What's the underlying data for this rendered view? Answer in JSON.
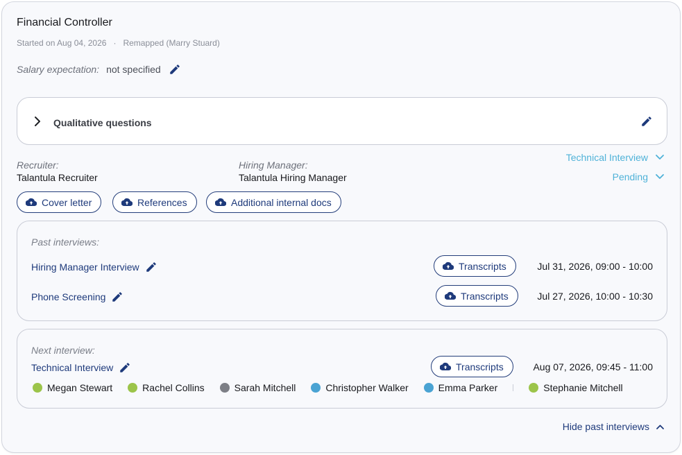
{
  "job": {
    "title": "Financial Controller",
    "started": "Started on Aug 04, 2026",
    "separator": "·",
    "remapped": "Remapped (Marry Stuard)"
  },
  "salary": {
    "label": "Salary expectation:",
    "value": "not specified"
  },
  "qualitative": {
    "label": "Qualitative questions"
  },
  "recruiter": {
    "label": "Recruiter:",
    "value": "Talantula Recruiter"
  },
  "hiring_manager": {
    "label": "Hiring Manager:",
    "value": "Talantula Hiring Manager"
  },
  "stage_dropdown": {
    "value": "Technical Interview"
  },
  "status_dropdown": {
    "value": "Pending"
  },
  "documents": [
    {
      "label": "Cover letter"
    },
    {
      "label": "References"
    },
    {
      "label": "Additional internal docs"
    }
  ],
  "past_interviews": {
    "label": "Past interviews:",
    "items": [
      {
        "name": "Hiring Manager Interview",
        "button": "Transcripts",
        "time": "Jul 31, 2026, 09:00 - 10:00"
      },
      {
        "name": "Phone Screening",
        "button": "Transcripts",
        "time": "Jul 27, 2026, 10:00 - 10:30"
      }
    ]
  },
  "next_interview": {
    "label": "Next interview:",
    "name": "Technical Interview",
    "button": "Transcripts",
    "time": "Aug 07, 2026, 09:45 - 11:00",
    "participants": [
      {
        "name": "Megan Stewart",
        "color": "#9cc44a"
      },
      {
        "name": "Rachel Collins",
        "color": "#9cc44a"
      },
      {
        "name": "Sarah Mitchell",
        "color": "#7d7f86"
      },
      {
        "name": "Christopher Walker",
        "color": "#4aa3d3"
      },
      {
        "name": "Emma Parker",
        "color": "#4aa3d3"
      },
      {
        "name": "Stephanie Mitchell",
        "color": "#9cc44a"
      }
    ]
  },
  "footer": {
    "hide_label": "Hide past interviews"
  },
  "colors": {
    "accent": "#1e3a7b",
    "dropdown": "#4fb2d8",
    "border": "#c9ccd6"
  },
  "icons": [
    "pencil-icon",
    "chevron-right-icon",
    "chevron-down-icon",
    "chevron-up-icon",
    "cloud-upload-icon"
  ]
}
